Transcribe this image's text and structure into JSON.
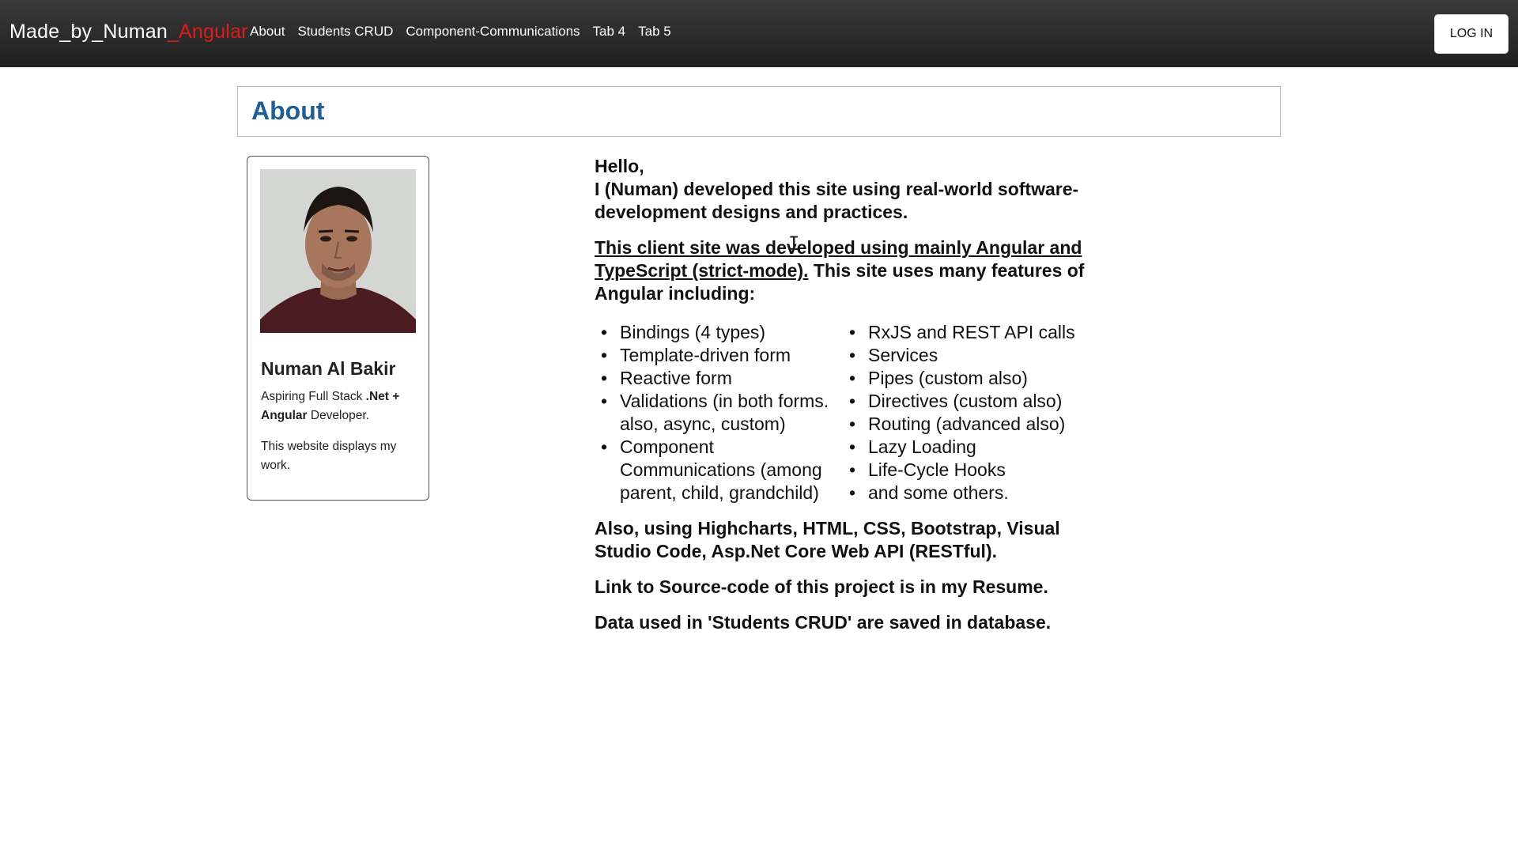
{
  "navbar": {
    "brand_main": "Made_by_Numan",
    "brand_accent": "_Angular",
    "links": [
      "About",
      "Students CRUD",
      "Component-Communications",
      "Tab 4",
      "Tab 5"
    ],
    "login_label": "LOG IN"
  },
  "page": {
    "title": "About"
  },
  "profile": {
    "name": "Numan Al Bakir",
    "desc_prefix": "Aspiring Full Stack ",
    "desc_bold1": ".Net +",
    "desc_bold2": "Angular",
    "desc_suffix": " Developer.",
    "note": "This website displays my work."
  },
  "content": {
    "greeting": "Hello,",
    "intro": "I (Numan) developed this site using real-world software-development designs and practices.",
    "underline_text": "This client site was developed using mainly Angular and TypeScript (strict-mode).",
    "features_intro": " This site uses many features of Angular including:",
    "features_left": [
      "Bindings (4 types)",
      "Template-driven form",
      "Reactive form",
      "Validations (in both forms. also, async, custom)",
      "Component Communications (among parent, child, grandchild)"
    ],
    "features_right": [
      "RxJS and REST API calls",
      "Services",
      "Pipes (custom also)",
      "Directives (custom also)",
      "Routing (advanced also)",
      "Lazy Loading",
      "Life-Cycle Hooks",
      "and some others."
    ],
    "tools": "Also, using Highcharts, HTML, CSS, Bootstrap, Visual Studio Code, Asp.Net Core Web API (RESTful).",
    "source": "Link to Source-code of this project is in my Resume.",
    "database": "Data used in 'Students CRUD' are saved in database."
  }
}
